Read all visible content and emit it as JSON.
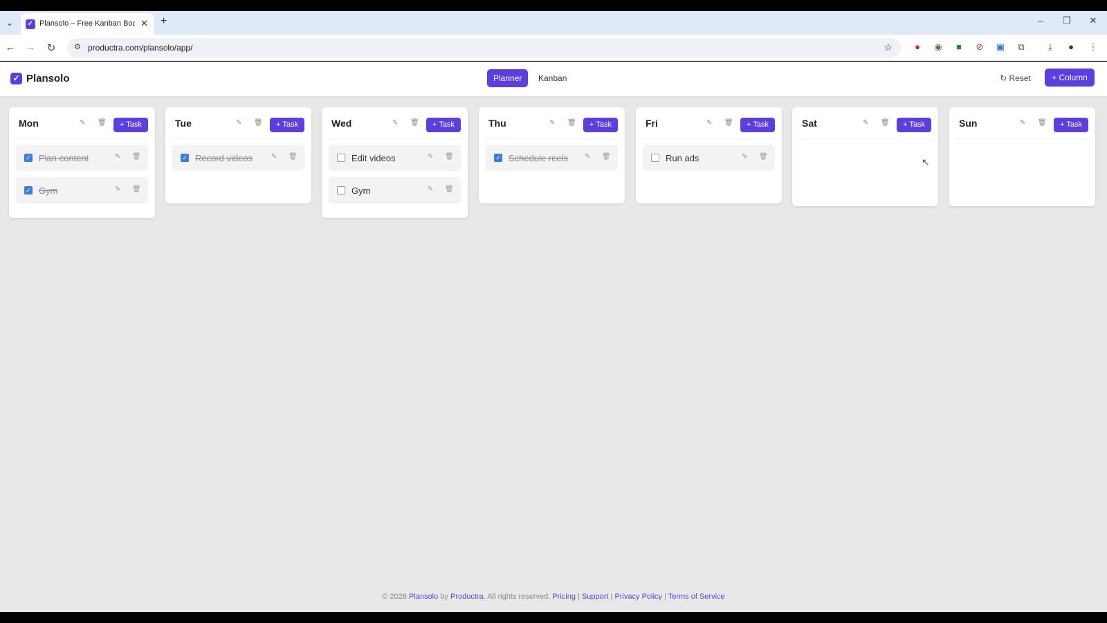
{
  "browser": {
    "tab_title": "Plansolo – Free Kanban Board &",
    "tab_close": "✕",
    "new_tab": "+",
    "url": "productra.com/plansolo/app/",
    "win_min": "–",
    "win_restore": "❐",
    "win_close": "✕"
  },
  "app": {
    "brand": "Plansolo",
    "views": [
      "Planner",
      "Kanban"
    ],
    "active_view": "Planner",
    "reset_label": "↻ Reset",
    "column_label": "+ Column",
    "add_task_label": "+ Task",
    "accent_color": "#5b3fe0"
  },
  "columns": [
    {
      "title": "Mon",
      "tasks": [
        {
          "label": "Plan content",
          "done": true
        },
        {
          "label": "Gym",
          "done": true
        }
      ]
    },
    {
      "title": "Tue",
      "tasks": [
        {
          "label": "Record videos",
          "done": true
        }
      ]
    },
    {
      "title": "Wed",
      "tasks": [
        {
          "label": "Edit videos",
          "done": false
        },
        {
          "label": "Gym",
          "done": false
        }
      ]
    },
    {
      "title": "Thu",
      "tasks": [
        {
          "label": "Schedule reels",
          "done": true
        }
      ]
    },
    {
      "title": "Fri",
      "tasks": [
        {
          "label": "Run ads",
          "done": false
        }
      ]
    },
    {
      "title": "Sat",
      "tasks": []
    },
    {
      "title": "Sun",
      "tasks": []
    }
  ],
  "footer": {
    "prefix": "© 2026 ",
    "brand": "Plansolo",
    "by": " by ",
    "company": "Productra",
    "rights": ". All rights reserved. ",
    "links": [
      "Pricing",
      "Support",
      "Privacy Policy",
      "Terms of Service"
    ],
    "separator": " | "
  }
}
